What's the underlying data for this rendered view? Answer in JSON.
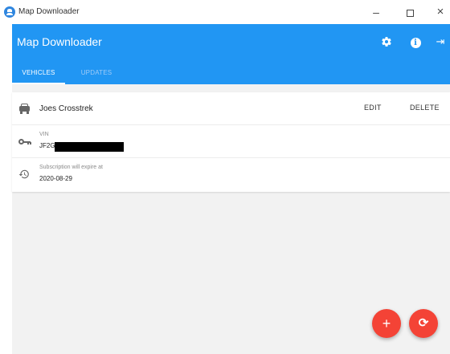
{
  "window": {
    "title": "Map Downloader",
    "min_glyph": "–",
    "close_glyph": "×"
  },
  "appbar": {
    "title": "Map Downloader",
    "background": "#2196f3",
    "icons": [
      "settings-icon",
      "info-icon",
      "exit-icon"
    ],
    "info_glyph": "i",
    "exit_glyph": "⇥"
  },
  "tabs": [
    {
      "label": "VEHICLES",
      "active": true
    },
    {
      "label": "UPDATES",
      "active": false
    }
  ],
  "vehicle": {
    "name": "Joes Crosstrek",
    "edit_label": "EDIT",
    "delete_label": "DELETE",
    "vin_label": "VIN",
    "vin_prefix": "JF2G",
    "subscription_label": "Subscription will expire at",
    "subscription_date": "2020-08-29"
  },
  "fabs": {
    "add_glyph": "+",
    "refresh_glyph": "⟳",
    "color": "#f44336"
  }
}
